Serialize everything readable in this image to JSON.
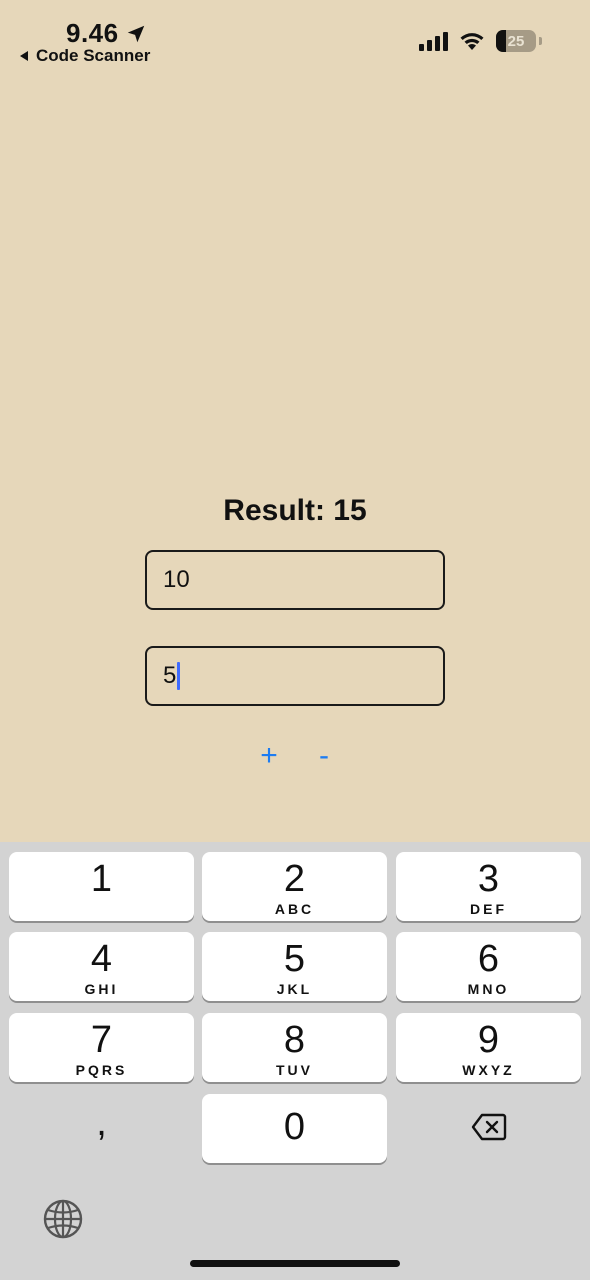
{
  "status_bar": {
    "time": "9.46",
    "back_app": "Code Scanner",
    "battery": "25",
    "location_icon": "location-arrow-icon",
    "signal_icon": "cellular-signal-icon",
    "wifi_icon": "wifi-icon",
    "battery_icon": "battery-icon"
  },
  "main": {
    "result_text": "Result: 15",
    "field1_value": "10",
    "field2_value": "5",
    "plus_label": "+",
    "minus_label": "-",
    "accent_color": "#1d7cf2",
    "background_color": "#e6d7ba"
  },
  "keyboard": {
    "keys": [
      {
        "digit": "1",
        "letters": ""
      },
      {
        "digit": "2",
        "letters": "ABC"
      },
      {
        "digit": "3",
        "letters": "DEF"
      },
      {
        "digit": "4",
        "letters": "GHI"
      },
      {
        "digit": "5",
        "letters": "JKL"
      },
      {
        "digit": "6",
        "letters": "MNO"
      },
      {
        "digit": "7",
        "letters": "PQRS"
      },
      {
        "digit": "8",
        "letters": "TUV"
      },
      {
        "digit": "9",
        "letters": "WXYZ"
      },
      {
        "digit": "0",
        "letters": ""
      }
    ],
    "comma": ",",
    "backspace_icon": "backspace-icon",
    "globe_icon": "globe-icon"
  }
}
